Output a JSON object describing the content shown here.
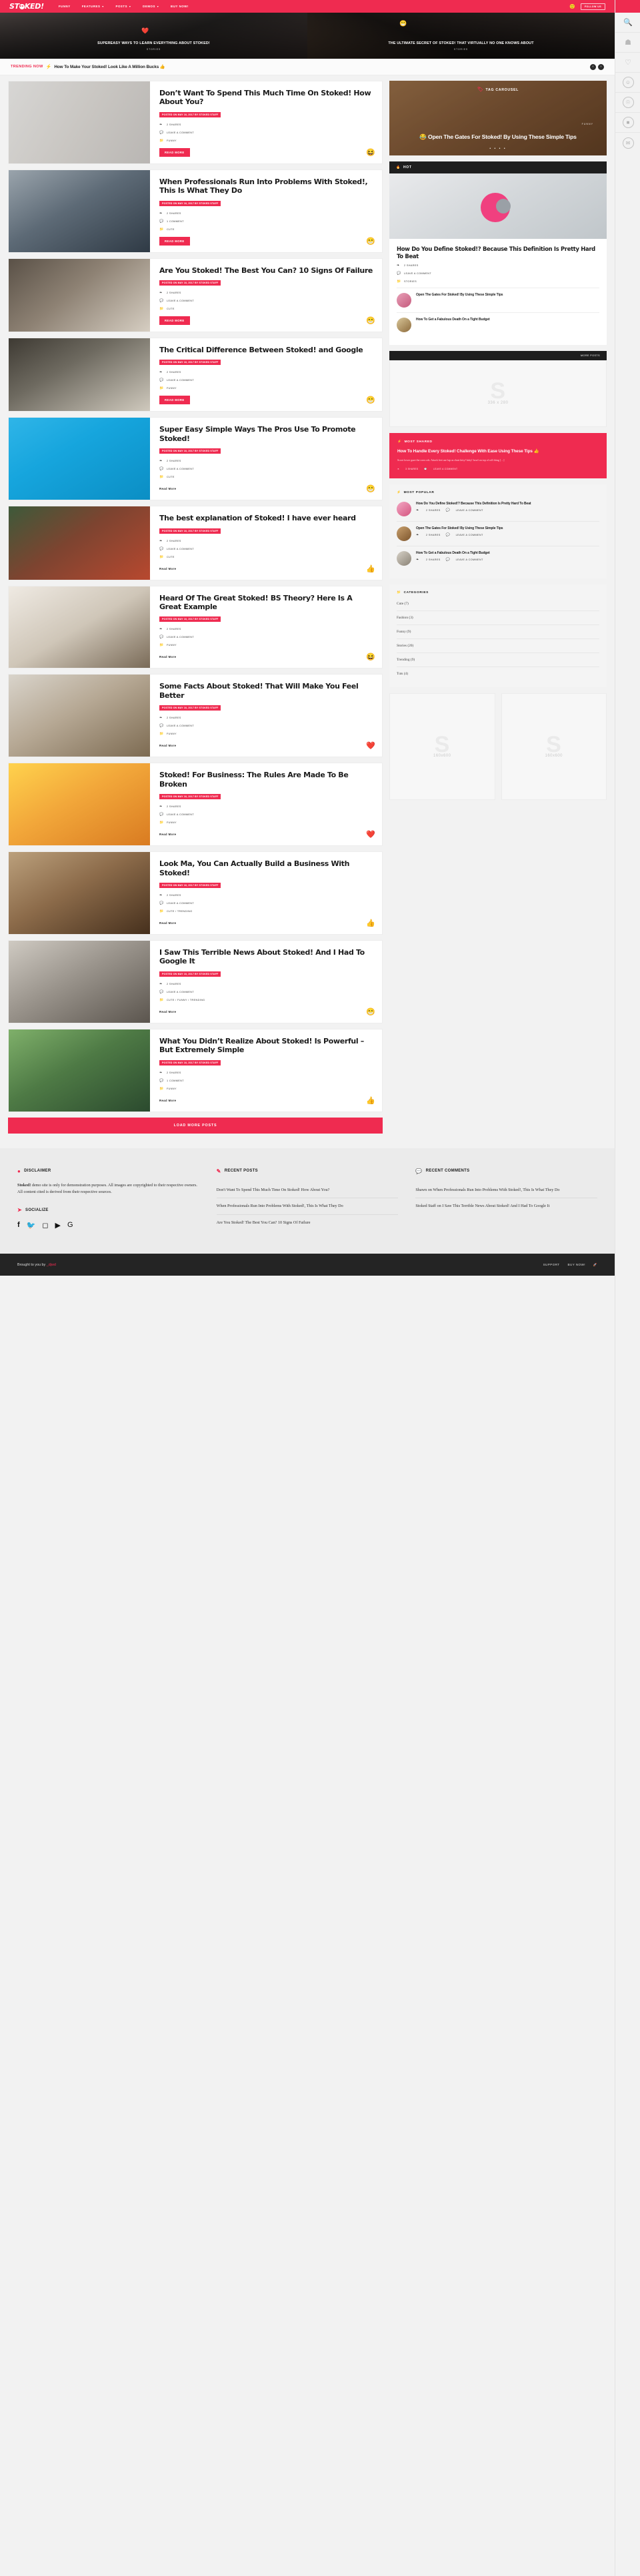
{
  "site": {
    "logo_text": "ST",
    "logo_text2": "KED!",
    "accent": "#ef2b50",
    "dark": "#1e1e1e"
  },
  "header": {
    "nav": [
      {
        "label": "FUNNY",
        "caret": false
      },
      {
        "label": "FEATURES",
        "caret": true
      },
      {
        "label": "POSTS",
        "caret": true
      },
      {
        "label": "DEMOS",
        "caret": true
      },
      {
        "label": "BUY NOW!",
        "caret": false
      }
    ],
    "follow_label": "FOLLOW US",
    "search_icon": "search-icon"
  },
  "hero": [
    {
      "title": "SUPEREASY WAYS TO LEARN EVERYTHING ABOUT STOKED!",
      "category": "STORIES",
      "emoji": "❤️"
    },
    {
      "title": "THE ULTIMATE SECRET OF STOKED! THAT VIRTUALLY NO ONE KNOWS ABOUT",
      "category": "STORIES",
      "emoji": "😁"
    }
  ],
  "trending": {
    "label": "TRENDING NOW",
    "bolt": "⚡",
    "headline": "How To Make Your Stoked! Look Like A Million Bucks 👍",
    "prev": "‹",
    "next": "›"
  },
  "posts": [
    {
      "title": "Don’t Want To Spend This Much Time On Stoked! How About You?",
      "meta": "POSTED ON MAY 16, 2017 BY STOKED STAFF",
      "shares": "2 SHARES",
      "comment": "LEAVE A COMMENT",
      "category": "FUNNY",
      "button": "READ MORE",
      "button_style": "filled",
      "reaction": "😆",
      "thumb_class": "th1"
    },
    {
      "title": "When Professionals Run Into Problems With Stoked!, This Is What They Do",
      "meta": "POSTED ON MAY 16, 2017 BY STOKED STAFF",
      "shares": "2 SHARES",
      "comment": "1 COMMENT",
      "category": "CUTE",
      "button": "READ MORE",
      "button_style": "filled",
      "reaction": "😁",
      "thumb_class": "th2"
    },
    {
      "title": "Are You Stoked! The Best You Can? 10 Signs Of Failure",
      "meta": "POSTED ON MAY 16, 2017 BY STOKED STAFF",
      "shares": "2 SHARES",
      "comment": "LEAVE A COMMENT",
      "category": "CUTE",
      "button": "READ MORE",
      "button_style": "filled",
      "reaction": "😁",
      "thumb_class": "th3"
    },
    {
      "title": "The Critical Difference Between Stoked! and Google",
      "meta": "POSTED ON MAY 16, 2017 BY STOKED STAFF",
      "shares": "2 SHARES",
      "comment": "LEAVE A COMMENT",
      "category": "FUNNY",
      "button": "READ MORE",
      "button_style": "filled",
      "reaction": "😁",
      "thumb_class": "th4"
    },
    {
      "title": "Super Easy Simple Ways The Pros Use To Promote Stoked!",
      "meta": "POSTED ON MAY 16, 2017 BY STOKED STAFF",
      "shares": "2 SHARES",
      "comment": "LEAVE A COMMENT",
      "category": "CUTE",
      "button": "Read More",
      "button_style": "plain",
      "reaction": "😁",
      "thumb_class": "th5"
    },
    {
      "title": "The best explanation of Stoked! I have ever heard",
      "meta": "POSTED ON MAY 16, 2017 BY STOKED STAFF",
      "shares": "2 SHARES",
      "comment": "LEAVE A COMMENT",
      "category": "CUTE",
      "button": "Read More",
      "button_style": "plain",
      "reaction": "👍",
      "thumb_class": "th6"
    },
    {
      "title": "Heard Of The Great Stoked! BS Theory? Here Is A Great Example",
      "meta": "POSTED ON MAY 16, 2017 BY STOKED STAFF",
      "shares": "2 SHARES",
      "comment": "LEAVE A COMMENT",
      "category": "FUNNY",
      "button": "Read More",
      "button_style": "plain",
      "reaction": "😆",
      "thumb_class": "th7"
    },
    {
      "title": "Some Facts About Stoked! That Will Make You Feel Better",
      "meta": "POSTED ON MAY 16, 2017 BY STOKED STAFF",
      "shares": "2 SHARES",
      "comment": "LEAVE A COMMENT",
      "category": "FUNNY",
      "button": "Read More",
      "button_style": "plain",
      "reaction": "❤️",
      "thumb_class": "th8"
    },
    {
      "title": "Stoked! For Business: The Rules Are Made To Be Broken",
      "meta": "POSTED ON MAY 16, 2017 BY STOKED STAFF",
      "shares": "2 SHARES",
      "comment": "LEAVE A COMMENT",
      "category": "FUNNY",
      "button": "Read More",
      "button_style": "plain",
      "reaction": "❤️",
      "thumb_class": "th9"
    },
    {
      "title": "Look Ma, You Can Actually Build a Business With Stoked!",
      "meta": "POSTED ON MAY 16, 2017 BY STOKED STAFF",
      "shares": "2 SHARES",
      "comment": "LEAVE A COMMENT",
      "category": "CUTE / TRENDING",
      "button": "Read More",
      "button_style": "plain",
      "reaction": "👍",
      "thumb_class": "th10"
    },
    {
      "title": "I Saw This Terrible News About Stoked! And I Had To Google It",
      "meta": "POSTED ON MAY 16, 2017 BY STOKED STAFF",
      "shares": "2 SHARES",
      "comment": "LEAVE A COMMENT",
      "category": "CUTE / FUNNY / TRENDING",
      "button": "Read More",
      "button_style": "plain",
      "reaction": "😁",
      "thumb_class": "th11"
    },
    {
      "title": "What You Didn’t Realize About Stoked! Is Powerful – But Extremely Simple",
      "meta": "POSTED ON MAY 16, 2017 BY STOKED STAFF",
      "shares": "2 SHARES",
      "comment": "1 COMMENT",
      "category": "FUNNY",
      "button": "Read More",
      "button_style": "plain",
      "reaction": "👍",
      "thumb_class": "th12"
    }
  ],
  "load_more": "LOAD MORE POSTS",
  "sidebar": {
    "tag_carousel": {
      "header": "TAG CAROUSEL",
      "tag_icon": "tag-icon",
      "title": "😂 Open The Gates For Stoked! By Using These Simple Tips",
      "category": "FUNNY",
      "dots": "• • • •"
    },
    "hot": {
      "header": "HOT",
      "flame_icon": "flame-icon",
      "title": "How Do You Define Stoked!? Because This Definition Is Pretty Hard To Beat",
      "shares": "2 SHARES",
      "comment": "LEAVE A COMMENT",
      "category": "STORIES",
      "related": [
        {
          "title": "Open The Gates For Stoked! By Using These Simple Tips"
        },
        {
          "title": "How To Get a Fabulous Death On a Tight Budget"
        }
      ]
    },
    "ad1": {
      "header": "MORE POSTS",
      "size": "336 x 280"
    },
    "most_shared": {
      "header": "MOST SHARED",
      "bolt_icon": "bolt-icon",
      "title": "How To Handle Every Stoked! Challenge With Ease Using These Tips 👍",
      "excerpt": "Scoot lower gaze the corn cob. Attack feet use lap as chair kitty! kitty! howl on top of roll thing […]",
      "shares": "3 SHARES",
      "comment": "LEAVE A COMMENT"
    },
    "most_popular": {
      "header": "MOST POPULAR",
      "bolt_icon": "bolt-icon",
      "items": [
        {
          "title": "How Do You Define Stoked!? Because This Definition Is Pretty Hard To Beat",
          "shares": "2 SHARES",
          "comment": "LEAVE A COMMENT"
        },
        {
          "title": "Open The Gates For Stoked! By Using These Simple Tips",
          "shares": "2 SHARES",
          "comment": "LEAVE A COMMENT"
        },
        {
          "title": "How To Get a Fabulous Death On a Tight Budget",
          "shares": "2 SHARES",
          "comment": "LEAVE A COMMENT"
        }
      ]
    },
    "categories": {
      "header": "CATEGORIES",
      "folder_icon": "folder-icon",
      "items": [
        {
          "label": "Cute (7)"
        },
        {
          "label": "Fashion (3)"
        },
        {
          "label": "Funny (9)"
        },
        {
          "label": "Stories (20)"
        },
        {
          "label": "Trending (9)"
        },
        {
          "label": "Tuts (4)"
        }
      ]
    },
    "ads_pair": [
      {
        "size": "160x600"
      },
      {
        "size": "160x600"
      }
    ]
  },
  "footer": {
    "disclaimer": {
      "header": "DISCLAIMER",
      "icon": "circle-icon",
      "brand": "Stoked!",
      "text": " demo site is only for demonstration purposes. All images are copyrighted to their respective owners. All content cited is derived from their respective sources."
    },
    "socialize": {
      "header": "SOCIALIZE",
      "icon": "paper-plane-icon",
      "networks": [
        "facebook-icon",
        "twitter-icon",
        "instagram-icon",
        "youtube-icon",
        "google-icon"
      ]
    },
    "recent_posts": {
      "header": "RECENT POSTS",
      "icon": "pencil-icon",
      "items": [
        "Don't Want To Spend This Much Time On Stoked! How About You?",
        "When Professionals Run Into Problems With Stoked!, This Is What They Do",
        "Are You Stoked! The Best You Can? 10 Signs Of Failure"
      ]
    },
    "recent_comments": {
      "header": "RECENT COMMENTS",
      "icon": "comment-icon",
      "items": [
        "Shawn on When Professionals Run Into Problems With Stoked!, This Is What They Do",
        "Stoked Staff on I Saw This Terrible News About Stoked! And I Had To Google It"
      ]
    },
    "bottom": {
      "brought": "Brought to you by ",
      "author": "_djwd",
      "links": [
        "SUPPORT",
        "BUY NOW!"
      ],
      "rocket": "🚀"
    }
  },
  "rail": {
    "icons": [
      "search-icon",
      "home-icon",
      "heart-icon",
      "smile-icon",
      "user-icon",
      "grid-icon",
      "mail-icon"
    ]
  }
}
